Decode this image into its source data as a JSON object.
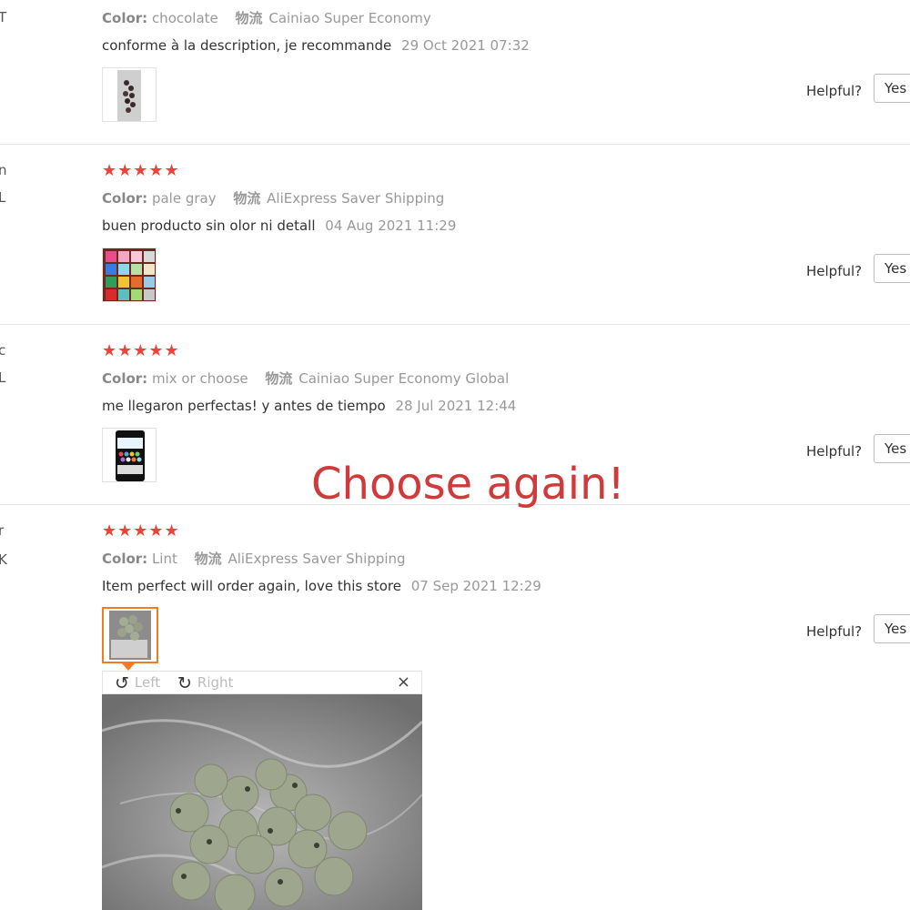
{
  "reviews": [
    {
      "cut_letter": "T",
      "stars": "",
      "color_key": "Color:",
      "color_value": "chocolate",
      "logistics_key": "物流",
      "logistics_value": "Cainiao Super Economy",
      "text": "conforme à la description, je recommande",
      "date": "29 Oct 2021 07:32",
      "helpful_label": "Helpful?",
      "yes_label": "Yes"
    },
    {
      "cut_letter": "L",
      "stars": "★★★★★",
      "color_key": "Color:",
      "color_value": "pale gray",
      "logistics_key": "物流",
      "logistics_value": "AliExpress Saver Shipping",
      "text": "buen producto sin olor ni detall",
      "date": "04 Aug 2021 11:29",
      "helpful_label": "Helpful?",
      "yes_label": "Yes"
    },
    {
      "cut_letter": "L",
      "stars": "★★★★★",
      "color_key": "Color:",
      "color_value": "mix or choose",
      "logistics_key": "物流",
      "logistics_value": "Cainiao Super Economy Global",
      "text": "me llegaron perfectas! y antes de tiempo",
      "date": "28 Jul 2021 12:44",
      "helpful_label": "Helpful?",
      "yes_label": "Yes"
    },
    {
      "cut_letter": "K",
      "stars": "★★★★★",
      "color_key": "Color:",
      "color_value": "Lint",
      "logistics_key": "物流",
      "logistics_value": "AliExpress Saver Shipping",
      "text": "Item perfect will order again, love this store",
      "date": "07 Sep 2021 12:29",
      "helpful_label": "Helpful?",
      "yes_label": "Yes"
    }
  ],
  "overlay_text": "Choose again!",
  "viewer": {
    "rotate_left_label": "Left",
    "rotate_right_label": "Right",
    "close_symbol": "×"
  },
  "colors": {
    "star": "#f0413a",
    "active_border": "#f47b20",
    "overlay_text": "#d03a3a"
  }
}
